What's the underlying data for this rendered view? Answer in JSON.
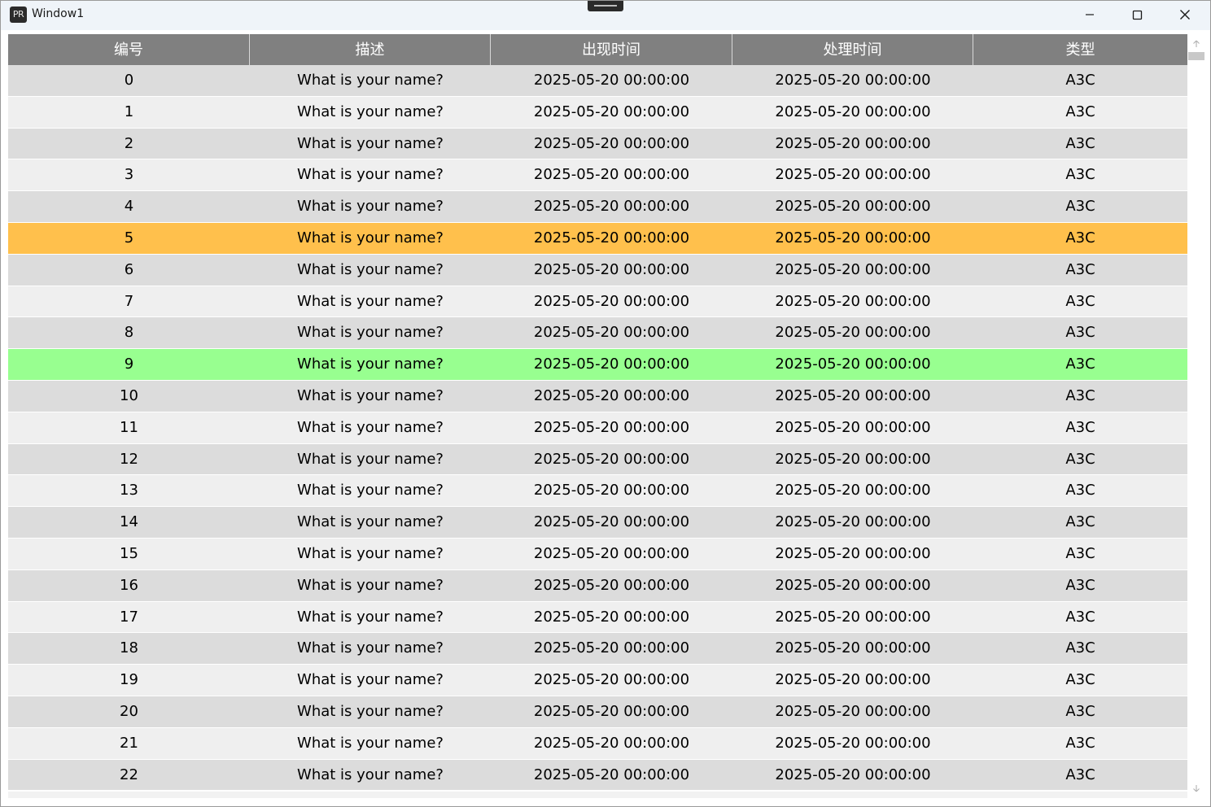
{
  "window": {
    "title": "Window1",
    "icon_label": "PR"
  },
  "columns": [
    "编号",
    "描述",
    "出现时间",
    "处理时间",
    "类型"
  ],
  "highlight_colors": {
    "5": "#ffc04c",
    "9": "#98ff90"
  },
  "rows": [
    [
      "0",
      "What is your name?",
      "2025-05-20 00:00:00",
      "2025-05-20 00:00:00",
      "A3C"
    ],
    [
      "1",
      "What is your name?",
      "2025-05-20 00:00:00",
      "2025-05-20 00:00:00",
      "A3C"
    ],
    [
      "2",
      "What is your name?",
      "2025-05-20 00:00:00",
      "2025-05-20 00:00:00",
      "A3C"
    ],
    [
      "3",
      "What is your name?",
      "2025-05-20 00:00:00",
      "2025-05-20 00:00:00",
      "A3C"
    ],
    [
      "4",
      "What is your name?",
      "2025-05-20 00:00:00",
      "2025-05-20 00:00:00",
      "A3C"
    ],
    [
      "5",
      "What is your name?",
      "2025-05-20 00:00:00",
      "2025-05-20 00:00:00",
      "A3C"
    ],
    [
      "6",
      "What is your name?",
      "2025-05-20 00:00:00",
      "2025-05-20 00:00:00",
      "A3C"
    ],
    [
      "7",
      "What is your name?",
      "2025-05-20 00:00:00",
      "2025-05-20 00:00:00",
      "A3C"
    ],
    [
      "8",
      "What is your name?",
      "2025-05-20 00:00:00",
      "2025-05-20 00:00:00",
      "A3C"
    ],
    [
      "9",
      "What is your name?",
      "2025-05-20 00:00:00",
      "2025-05-20 00:00:00",
      "A3C"
    ],
    [
      "10",
      "What is your name?",
      "2025-05-20 00:00:00",
      "2025-05-20 00:00:00",
      "A3C"
    ],
    [
      "11",
      "What is your name?",
      "2025-05-20 00:00:00",
      "2025-05-20 00:00:00",
      "A3C"
    ],
    [
      "12",
      "What is your name?",
      "2025-05-20 00:00:00",
      "2025-05-20 00:00:00",
      "A3C"
    ],
    [
      "13",
      "What is your name?",
      "2025-05-20 00:00:00",
      "2025-05-20 00:00:00",
      "A3C"
    ],
    [
      "14",
      "What is your name?",
      "2025-05-20 00:00:00",
      "2025-05-20 00:00:00",
      "A3C"
    ],
    [
      "15",
      "What is your name?",
      "2025-05-20 00:00:00",
      "2025-05-20 00:00:00",
      "A3C"
    ],
    [
      "16",
      "What is your name?",
      "2025-05-20 00:00:00",
      "2025-05-20 00:00:00",
      "A3C"
    ],
    [
      "17",
      "What is your name?",
      "2025-05-20 00:00:00",
      "2025-05-20 00:00:00",
      "A3C"
    ],
    [
      "18",
      "What is your name?",
      "2025-05-20 00:00:00",
      "2025-05-20 00:00:00",
      "A3C"
    ],
    [
      "19",
      "What is your name?",
      "2025-05-20 00:00:00",
      "2025-05-20 00:00:00",
      "A3C"
    ],
    [
      "20",
      "What is your name?",
      "2025-05-20 00:00:00",
      "2025-05-20 00:00:00",
      "A3C"
    ],
    [
      "21",
      "What is your name?",
      "2025-05-20 00:00:00",
      "2025-05-20 00:00:00",
      "A3C"
    ],
    [
      "22",
      "What is your name?",
      "2025-05-20 00:00:00",
      "2025-05-20 00:00:00",
      "A3C"
    ]
  ]
}
